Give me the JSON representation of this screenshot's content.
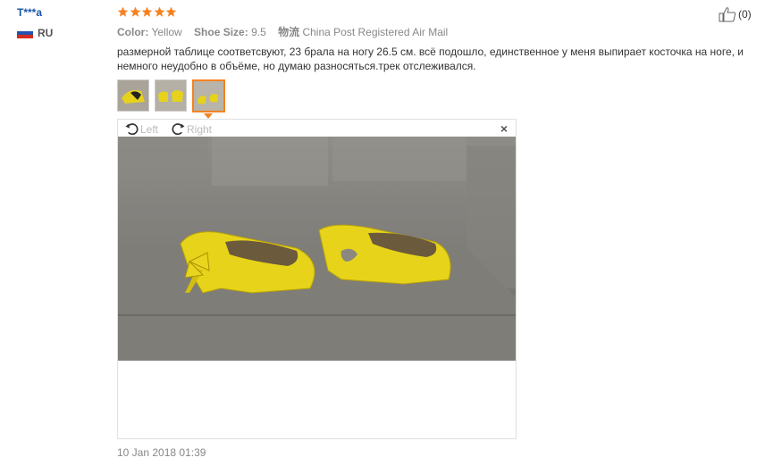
{
  "user": {
    "name": "T***a",
    "country": "RU"
  },
  "rating": {
    "stars": 5
  },
  "attributes": [
    {
      "label": "Color:",
      "value": "Yellow"
    },
    {
      "label": "Shoe Size:",
      "value": "9.5"
    },
    {
      "label": "物流",
      "value": "China Post Registered Air Mail"
    }
  ],
  "review_text": "размерной таблице соответсвуют, 23 брала на ногу 26.5 см. всё подошло, единственное у меня выпирает косточка на ноге, и немного неудобно в объёме, но думаю разносяться.трек отслеживался.",
  "thumbnails": {
    "count": 3,
    "active_index": 2
  },
  "viewer": {
    "rotate_left_label": "Left",
    "rotate_right_label": "Right",
    "close_label": "×"
  },
  "helpful": {
    "count_label": "(0)"
  },
  "date": "10 Jan 2018 01:39",
  "colors": {
    "accent": "#f58220",
    "username": "#1a56a8",
    "star": "#f58220"
  }
}
